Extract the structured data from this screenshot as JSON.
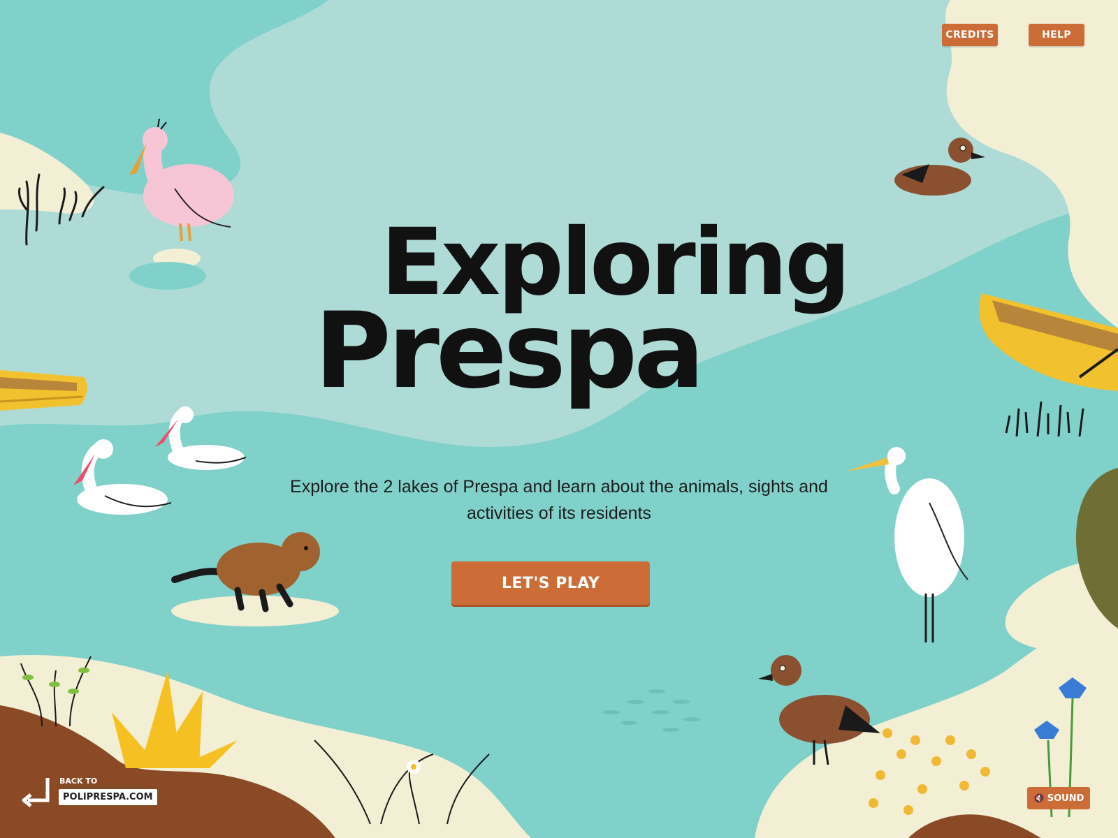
{
  "header": {
    "credits_label": "CREDITS",
    "help_label": "HELP"
  },
  "hero": {
    "title_line1": "Exploring",
    "title_line2": "Prespa",
    "subtitle": "Explore the 2 lakes of Prespa and learn about the animals, sights and activities of its residents",
    "play_label": "LET'S PLAY"
  },
  "footer": {
    "back_small": "BACK TO",
    "back_main": "POLIPRESPA.COM",
    "sound_label": "SOUND",
    "sound_icon": "speaker-muted-icon"
  },
  "colors": {
    "water_light": "#aedbd6",
    "water_deep": "#80d1ca",
    "sand": "#f3efd5",
    "button": "#cc6d38",
    "title": "#111111",
    "boat": "#f2c12e",
    "earth": "#8a4a26"
  }
}
